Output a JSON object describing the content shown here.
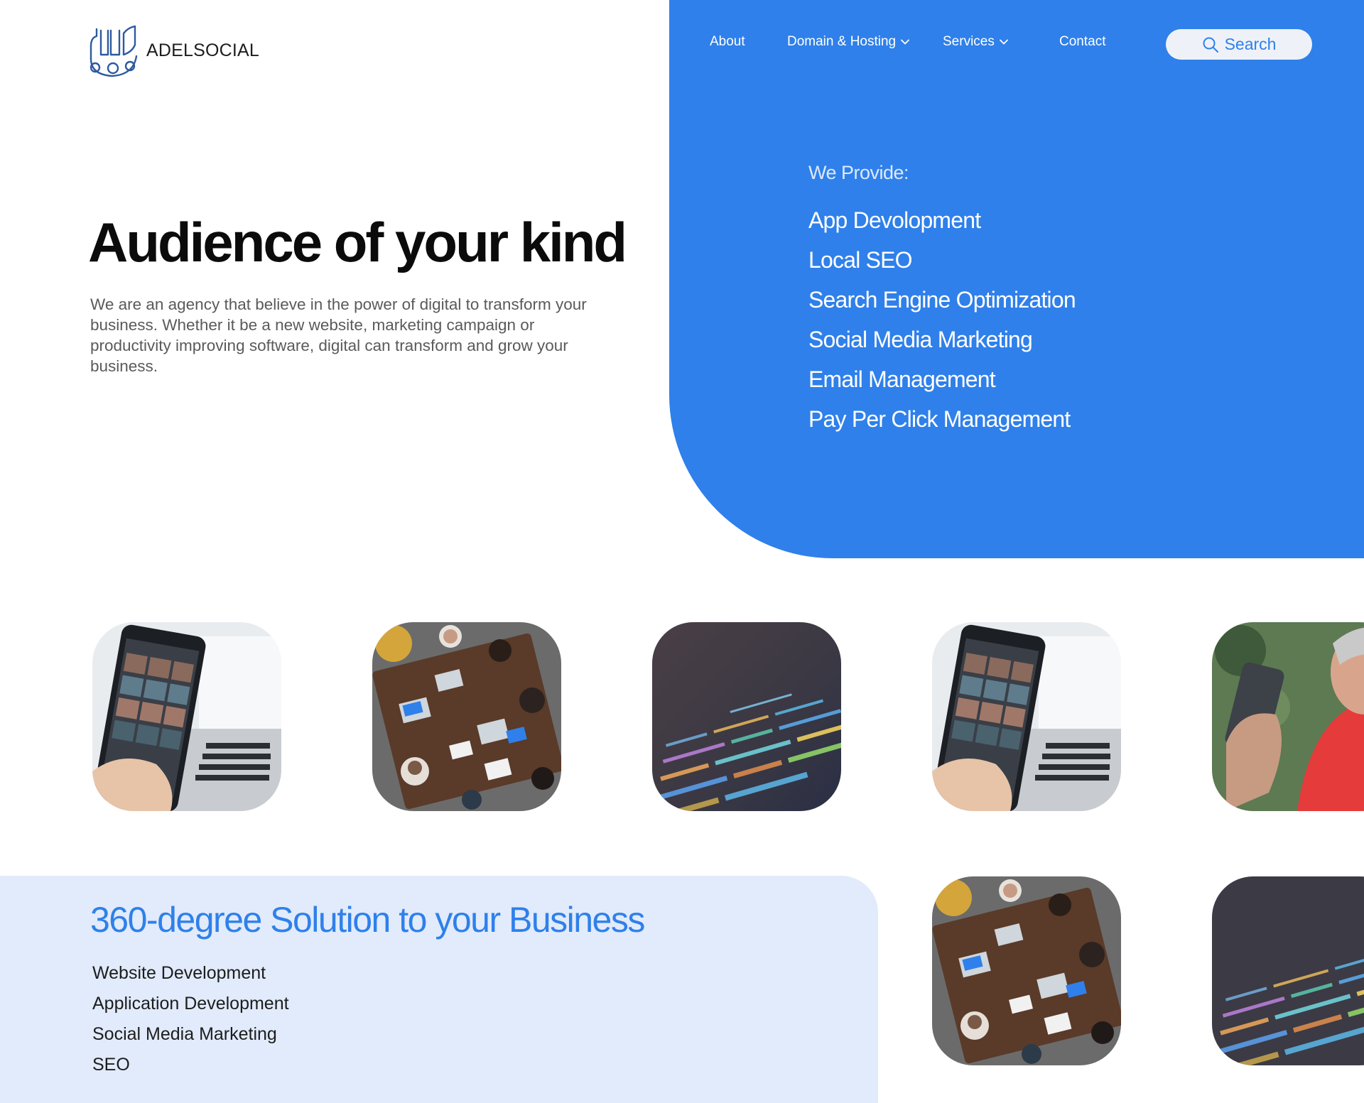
{
  "brand": {
    "name": "ADELSOCIAL",
    "logo_icon": "adelsocial-logo-icon"
  },
  "nav": {
    "items": [
      {
        "label": "About",
        "has_dropdown": false
      },
      {
        "label": "Domain & Hosting",
        "has_dropdown": true
      },
      {
        "label": "Services",
        "has_dropdown": true
      },
      {
        "label": "Contact",
        "has_dropdown": false
      }
    ],
    "search_label": "Search"
  },
  "hero": {
    "title": "Audience of your kind",
    "description": "We are an agency that believe in the power of digital to transform your business. Whether it be a new website, marketing campaign or productivity improving software, digital can transform and grow your business."
  },
  "provide": {
    "label": "We Provide:",
    "items": [
      "App Devolopment",
      "Local SEO",
      "Search Engine Optimization",
      "Social Media Marketing",
      "Email Management",
      "Pay Per Click Management"
    ]
  },
  "gallery": {
    "images": [
      {
        "subject": "phone-with-photo-grid"
      },
      {
        "subject": "team-meeting-overhead"
      },
      {
        "subject": "code-on-screen"
      },
      {
        "subject": "phone-with-photo-grid"
      },
      {
        "subject": "woman-with-phone"
      },
      {
        "subject": "team-meeting-overhead"
      },
      {
        "subject": "code-on-screen"
      }
    ]
  },
  "solution": {
    "title": "360-degree Solution to your Business",
    "items": [
      "Website Development",
      "Application Development",
      "Social Media Marketing",
      "SEO"
    ]
  },
  "colors": {
    "accent": "#2f80ea",
    "light_panel": "#e1ebfb",
    "search_bg": "#eef2f8"
  }
}
